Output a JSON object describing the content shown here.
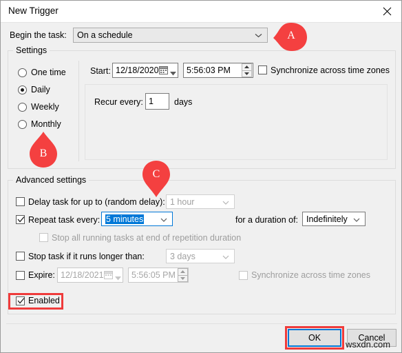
{
  "window": {
    "title": "New Trigger",
    "close_icon": "close-icon"
  },
  "begin_task": {
    "label": "Begin the task:",
    "value": "On a schedule",
    "arrow": "chevron-down-icon"
  },
  "settings": {
    "group_title": "Settings",
    "radios": [
      {
        "label": "One time",
        "checked": false
      },
      {
        "label": "Daily",
        "checked": true
      },
      {
        "label": "Weekly",
        "checked": false
      },
      {
        "label": "Monthly",
        "checked": false
      }
    ],
    "start_label": "Start:",
    "start_date": "12/18/2020",
    "start_time": "5:56:03 PM",
    "calendar_icon": "calendar-icon",
    "sync_label": "Synchronize across time zones",
    "sync_checked": false,
    "recur_label": "Recur every:",
    "recur_value": "1",
    "recur_unit": "days"
  },
  "advanced": {
    "group_title": "Advanced settings",
    "delay_label": "Delay task for up to (random delay):",
    "delay_checked": false,
    "delay_value": "1 hour",
    "repeat_label": "Repeat task every:",
    "repeat_checked": true,
    "repeat_value": "5 minutes",
    "duration_label": "for a duration of:",
    "duration_value": "Indefinitely",
    "stop_all_label": "Stop all running tasks at end of repetition duration",
    "stop_all_checked": false,
    "stop_longer_label": "Stop task if it runs longer than:",
    "stop_longer_checked": false,
    "stop_longer_value": "3 days",
    "expire_label": "Expire:",
    "expire_checked": false,
    "expire_date": "12/18/2021",
    "expire_time": "5:56:05 PM",
    "expire_sync_label": "Synchronize across time zones",
    "expire_sync_checked": false,
    "enabled_label": "Enabled",
    "enabled_checked": true
  },
  "footer": {
    "ok_label": "OK",
    "cancel_label": "Cancel"
  },
  "annotations": {
    "marker_a": "A",
    "marker_b": "B",
    "marker_c": "C",
    "color": "#ef3b3b"
  },
  "watermark": {
    "text": "wsxdn.com"
  }
}
